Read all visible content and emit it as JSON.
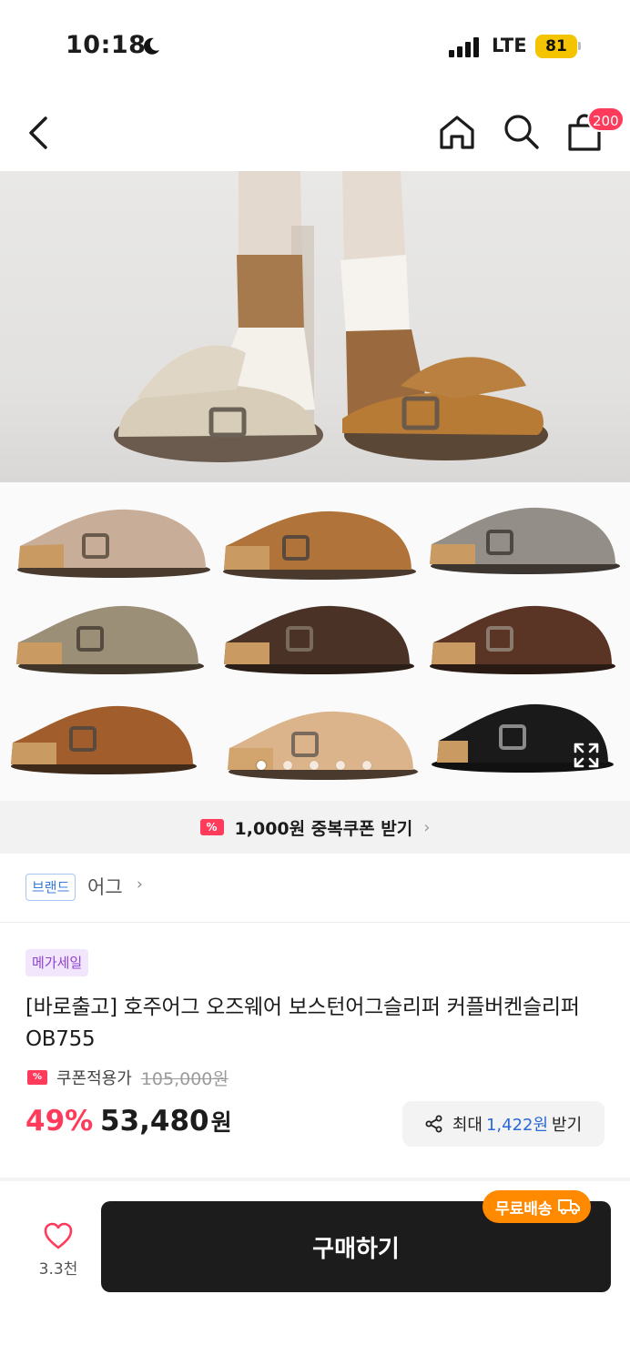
{
  "status_bar": {
    "time": "10:18",
    "network": "LTE",
    "battery": "81"
  },
  "nav": {
    "cart_count": "200"
  },
  "gallery": {
    "page_count": 5,
    "active_index": 0,
    "variant_colors": [
      "#c8ad98",
      "#b0733a",
      "#938e87",
      "#9c8f78",
      "#4a3326",
      "#5a3526",
      "#a15d2b",
      "#dcb48c",
      "#1a1a1a"
    ]
  },
  "coupon_banner": {
    "text": "1,000원 중복쿠폰 받기"
  },
  "brand": {
    "tag": "브랜드",
    "name": "어그"
  },
  "product": {
    "badge": "메가세일",
    "title": "[바로출고] 호주어그 오즈웨어 보스턴어그슬리퍼 커플버켄슬리퍼 OB755",
    "coupon_label": "쿠폰적용가",
    "original_price": "105,000원",
    "discount": "49%",
    "price": "53,480",
    "currency": "원"
  },
  "share": {
    "prefix": "최대",
    "amount": "1,422원",
    "suffix": "받기"
  },
  "bottom_bar": {
    "like_count": "3.3천",
    "buy_label": "구매하기",
    "free_shipping": "무료배송"
  },
  "colors": {
    "accent": "#ff3b5c",
    "buy_button": "#1c1c1c",
    "free_shipping": "#ff8a00",
    "link_blue": "#2a6ad6"
  }
}
